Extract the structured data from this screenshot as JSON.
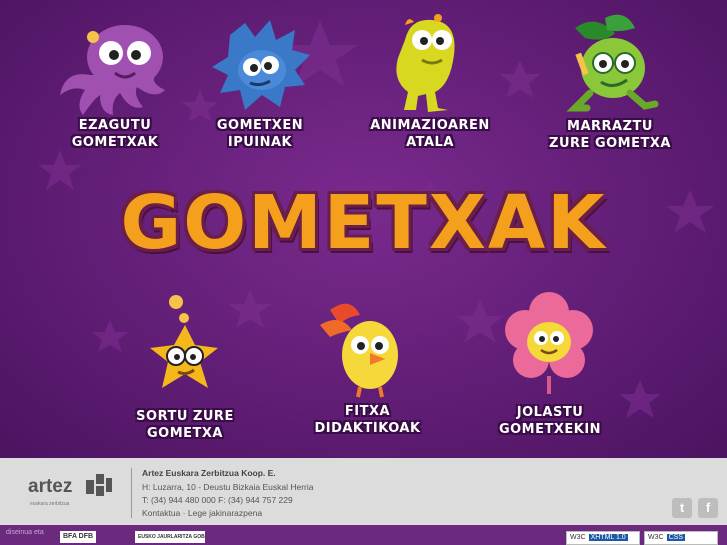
{
  "nav": {
    "top": [
      {
        "line1": "EZAGUTU",
        "line2": "GOMETXAK"
      },
      {
        "line1": "GOMETXEN",
        "line2": "IPUINAK"
      },
      {
        "line1": "ANIMAZIOAREN",
        "line2": "ATALA"
      },
      {
        "line1": "MARRAZTU",
        "line2": "ZURE GOMETXA"
      }
    ],
    "bottom": [
      {
        "line1": "SORTU ZURE",
        "line2": "GOMETXA"
      },
      {
        "line1": "FITXA",
        "line2": "DIDAKTIKOAK"
      },
      {
        "line1": "JOLASTU",
        "line2": "GOMETXEKIN"
      }
    ]
  },
  "title": "GOMETXAK",
  "footer": {
    "logo_text": "artez",
    "logo_subtitle": "euskara zerbitzua",
    "company": "Artez Euskara Zerbitzua Koop. E.",
    "address": "H: Luzarra, 10 - Deustu Bizkaia Euskal Herria",
    "phone": "T: (34) 944 480 000 F: (34) 944 757 229",
    "link_contact": "Kontaktua",
    "link_separator": "·",
    "link_legal": "Lege jakinarazpena",
    "twitter_glyph": "t",
    "facebook_glyph": "f"
  },
  "bottom_bar": {
    "credit": "diseinua eta",
    "sponsor1": "BFA DFB",
    "sponsor2": "EUSKO JAURLARITZA GOBIERNO VASCO",
    "badge_xhtml_left": "W3C",
    "badge_xhtml_right": "XHTML 1.0",
    "badge_css_left": "W3C",
    "badge_css_right": "CSS"
  },
  "colors": {
    "background": "#65207a",
    "title": "#f5a01c",
    "footer": "#dcdcdc"
  }
}
